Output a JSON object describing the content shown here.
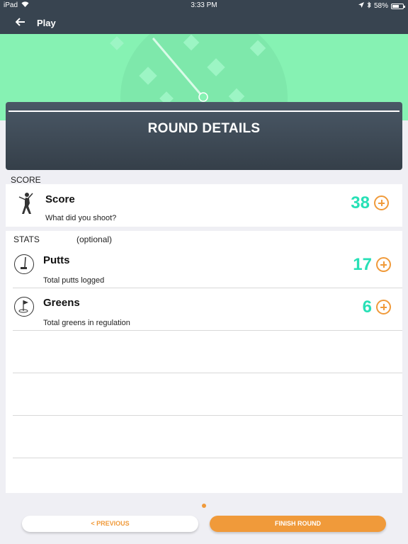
{
  "status_bar": {
    "device": "iPad",
    "time": "3:33 PM",
    "battery": "58%"
  },
  "nav": {
    "title": "Play"
  },
  "card": {
    "title": "ROUND DETAILS"
  },
  "score_section": {
    "label": "SCORE",
    "row": {
      "title": "Score",
      "subtitle": "What did you shoot?",
      "value": "38"
    }
  },
  "stats_section": {
    "label": "STATS",
    "optional": "(optional)",
    "rows": [
      {
        "title": "Putts",
        "subtitle": "Total putts logged",
        "value": "17"
      },
      {
        "title": "Greens",
        "subtitle": "Total greens in regulation",
        "value": "6"
      }
    ]
  },
  "footer": {
    "previous_label": "< PREVIOUS",
    "finish_label": "FINISH ROUND"
  },
  "colors": {
    "accent": "#f09a3a",
    "value": "#27e0b6",
    "hero": "#86f2b3",
    "nav": "#384450"
  }
}
